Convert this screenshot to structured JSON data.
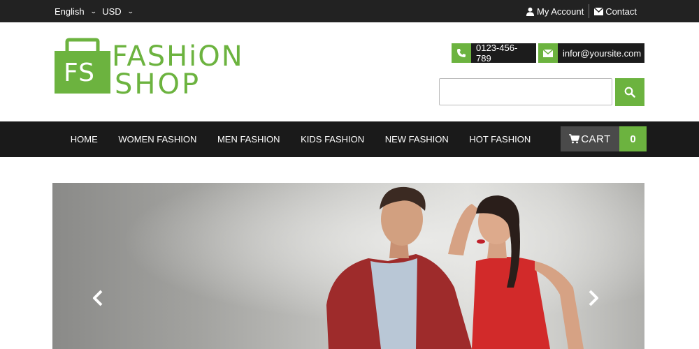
{
  "topbar": {
    "language": "English",
    "currency": "USD",
    "my_account": "My Account",
    "contact": "Contact"
  },
  "logo": {
    "monogram": "FS",
    "line1": "FASHiON",
    "line2": "SHOP"
  },
  "header": {
    "phone": "0123-456-789",
    "email": "infor@yoursite.com",
    "search_placeholder": ""
  },
  "nav": {
    "items": [
      "HOME",
      "WOMEN FASHION",
      "MEN FASHION",
      "KIDS FASHION",
      "NEW FASHION",
      "HOT FASHION"
    ]
  },
  "cart": {
    "label": "CART",
    "count": "0"
  },
  "icons": {
    "user": "user-icon",
    "contact": "envelope-icon",
    "phone": "phone-icon",
    "email": "envelope-icon",
    "search": "search-icon",
    "cart": "cart-icon",
    "prev": "chevron-left-icon",
    "next": "chevron-right-icon"
  },
  "colors": {
    "accent": "#6cb33f",
    "topbar": "#222222",
    "navbar": "#1a1a1a",
    "cart_label_bg": "#4a4a4a"
  }
}
